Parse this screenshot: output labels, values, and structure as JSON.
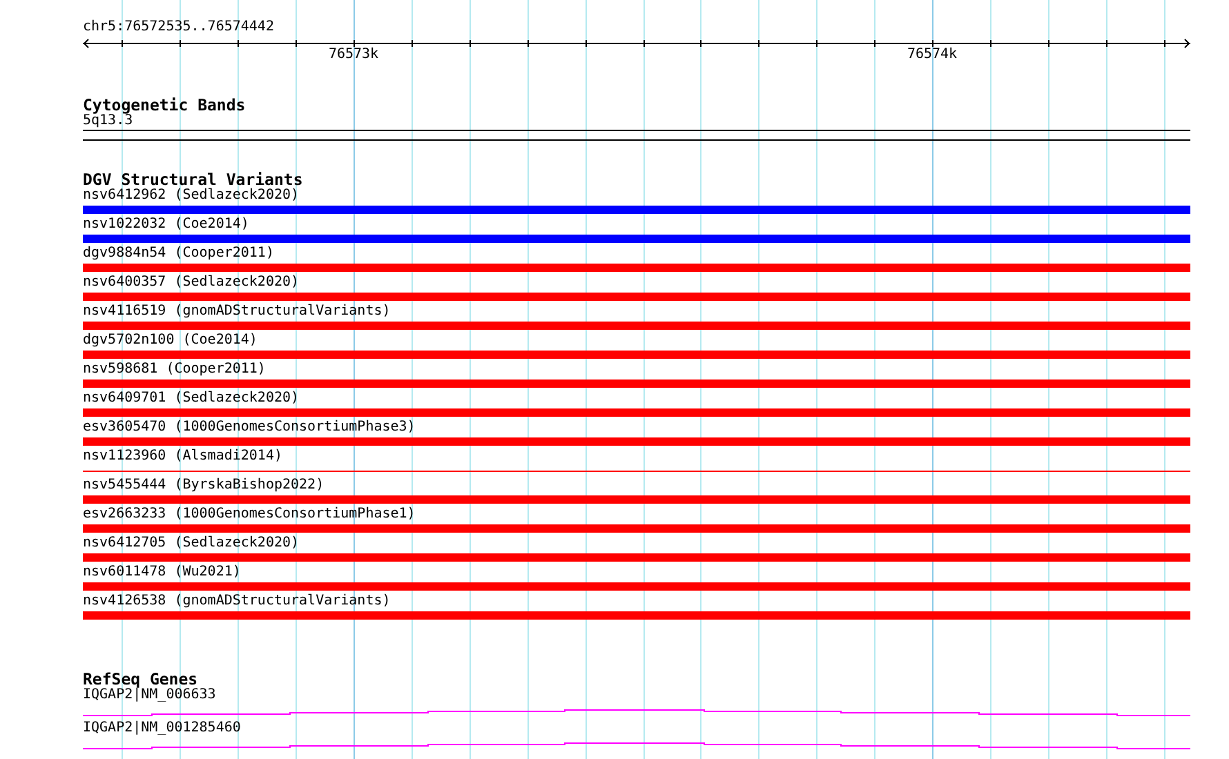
{
  "location": "chr5:76572535..76574442",
  "ruler": {
    "ticks": [
      {
        "label": "76573k"
      },
      {
        "label": "76574k"
      }
    ]
  },
  "tracks": [
    {
      "kind": "bands",
      "title": "Cytogenetic Bands",
      "features": [
        {
          "label": "5q13.3"
        }
      ]
    },
    {
      "kind": "variants",
      "title": "DGV Structural Variants",
      "features": [
        {
          "label": "nsv6412962 (Sedlazeck2020)",
          "color": "#0000ff",
          "kind": "bar"
        },
        {
          "label": "nsv1022032 (Coe2014)",
          "color": "#0000ff",
          "kind": "bar"
        },
        {
          "label": "dgv9884n54 (Cooper2011)",
          "color": "#ff0000",
          "kind": "bar"
        },
        {
          "label": "nsv6400357 (Sedlazeck2020)",
          "color": "#ff0000",
          "kind": "bar"
        },
        {
          "label": "nsv4116519 (gnomADStructuralVariants)",
          "color": "#ff0000",
          "kind": "bar"
        },
        {
          "label": "dgv5702n100 (Coe2014)",
          "color": "#ff0000",
          "kind": "bar"
        },
        {
          "label": "nsv598681 (Cooper2011)",
          "color": "#ff0000",
          "kind": "bar"
        },
        {
          "label": "nsv6409701 (Sedlazeck2020)",
          "color": "#ff0000",
          "kind": "bar"
        },
        {
          "label": "esv3605470 (1000GenomesConsortiumPhase3)",
          "color": "#ff0000",
          "kind": "bar"
        },
        {
          "label": "nsv1123960 (Alsmadi2014)",
          "color": "#ff0000",
          "kind": "line"
        },
        {
          "label": "nsv5455444 (ByrskaBishop2022)",
          "color": "#ff0000",
          "kind": "bar"
        },
        {
          "label": "esv2663233 (1000GenomesConsortiumPhase1)",
          "color": "#ff0000",
          "kind": "bar"
        },
        {
          "label": "nsv6412705 (Sedlazeck2020)",
          "color": "#ff0000",
          "kind": "bar"
        },
        {
          "label": "nsv6011478 (Wu2021)",
          "color": "#ff0000",
          "kind": "bar"
        },
        {
          "label": "nsv4126538 (gnomADStructuralVariants)",
          "color": "#ff0000",
          "kind": "bar"
        }
      ]
    },
    {
      "kind": "genes",
      "title": "RefSeq Genes",
      "features": [
        {
          "label": "IQGAP2|NM_006633"
        },
        {
          "label": "IQGAP2|NM_001285460"
        }
      ]
    }
  ]
}
